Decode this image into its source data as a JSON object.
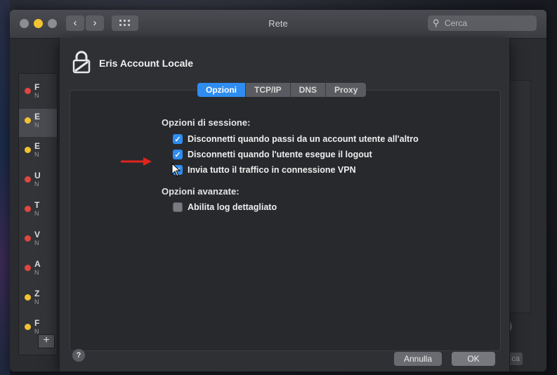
{
  "window": {
    "title": "Rete",
    "search_placeholder": "Cerca"
  },
  "sidebar": {
    "items": [
      {
        "label": "F",
        "sub": "N",
        "status": "#e0463e"
      },
      {
        "label": "E",
        "sub": "N",
        "status": "#f2c230"
      },
      {
        "label": "E",
        "sub": "N",
        "status": "#f2c230"
      },
      {
        "label": "U",
        "sub": "N",
        "status": "#e0463e"
      },
      {
        "label": "T",
        "sub": "N",
        "status": "#e0463e"
      },
      {
        "label": "V",
        "sub": "N",
        "status": "#e0463e"
      },
      {
        "label": "A",
        "sub": "N",
        "status": "#e0463e"
      },
      {
        "label": "Z",
        "sub": "N",
        "status": "#f2c230"
      },
      {
        "label": "F",
        "sub": "N",
        "status": "#f2c230"
      }
    ],
    "add_label": "+"
  },
  "sheet": {
    "title": "Eris Account Locale",
    "tabs": [
      {
        "label": "Opzioni",
        "active": true
      },
      {
        "label": "TCP/IP",
        "active": false
      },
      {
        "label": "DNS",
        "active": false
      },
      {
        "label": "Proxy",
        "active": false
      }
    ],
    "session_options": {
      "heading": "Opzioni di sessione:",
      "items": [
        {
          "label": "Disconnetti quando passi da un account utente all'altro",
          "checked": true
        },
        {
          "label": "Disconnetti quando l'utente esegue il logout",
          "checked": true
        },
        {
          "label": "Invia tutto il traffico in connessione VPN",
          "checked": true
        }
      ]
    },
    "advanced_options": {
      "heading": "Opzioni avanzate:",
      "items": [
        {
          "label": "Abilita log dettagliato",
          "checked": false
        }
      ]
    },
    "buttons": {
      "help": "?",
      "cancel": "Annulla",
      "ok": "OK"
    }
  },
  "background": {
    "help": "?",
    "partial_button": "ca"
  },
  "colors": {
    "accent": "#2f8cf0",
    "annotation_arrow": "#e0241b"
  }
}
